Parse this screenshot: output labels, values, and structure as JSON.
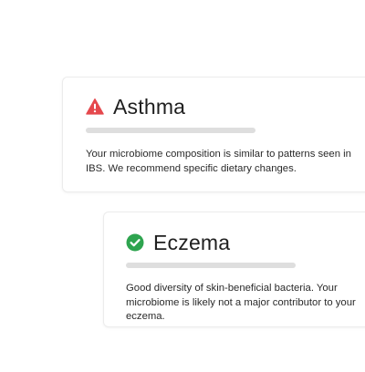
{
  "cards": [
    {
      "title": "Asthma",
      "status": "warning",
      "icon": "warning-triangle-icon",
      "icon_color": "#e5484d",
      "description": "Your microbiome composition is similar to patterns seen in IBS. We recommend specific dietary changes."
    },
    {
      "title": "Eczema",
      "status": "ok",
      "icon": "check-circle-icon",
      "icon_color": "#2ea44f",
      "description": "Good diversity of skin-beneficial bacteria. Your microbiome is likely not a major contributor to your eczema."
    }
  ]
}
